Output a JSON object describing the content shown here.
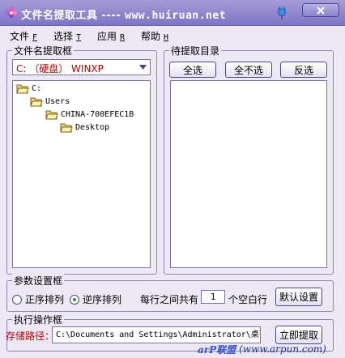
{
  "window": {
    "title_prefix": "文件名提取工具 ---- ",
    "title_url": "www.huiruan.net",
    "colors": {
      "titlebar": "#8f86cf",
      "accent": "#c00000",
      "border": "#7a72b0"
    }
  },
  "menu": [
    {
      "label": "文件",
      "hotkey": "F"
    },
    {
      "label": "选择",
      "hotkey": "T"
    },
    {
      "label": "应用",
      "hotkey": "R"
    },
    {
      "label": "帮助",
      "hotkey": "H"
    }
  ],
  "left_panel": {
    "title": "文件名提取框",
    "drive_value": "C: （硬盘）  WINXP",
    "tree": [
      {
        "label": "C:"
      },
      {
        "label": "Users"
      },
      {
        "label": "CHINA-700EFEC1B"
      },
      {
        "label": "Desktop"
      }
    ]
  },
  "right_panel": {
    "title": "待提取目录",
    "buttons": {
      "select_all": "全选",
      "select_none": "全不选",
      "invert": "反选"
    }
  },
  "params": {
    "title": "参数设置框",
    "ascending": "正序排列",
    "descending": "逆序排列",
    "selected": "descending",
    "blank_prefix": "每行之间共有",
    "blank_count": "1",
    "blank_suffix": "个空白行",
    "default_btn": "默认设置"
  },
  "exec": {
    "title": "执行操作框",
    "path_label": "存储路径：",
    "path_value": "C:\\Documents and Settings\\Administrator\\桌面",
    "extract_btn": "立即提取"
  },
  "watermark": {
    "brand": "arP联盟",
    "url": "(www.arpun.com)"
  },
  "icons": {
    "app": "flower-icon",
    "pin": "pin-icon",
    "close": "close-icon",
    "folder": "folder-icon",
    "dropdown": "chevron-down-icon"
  }
}
